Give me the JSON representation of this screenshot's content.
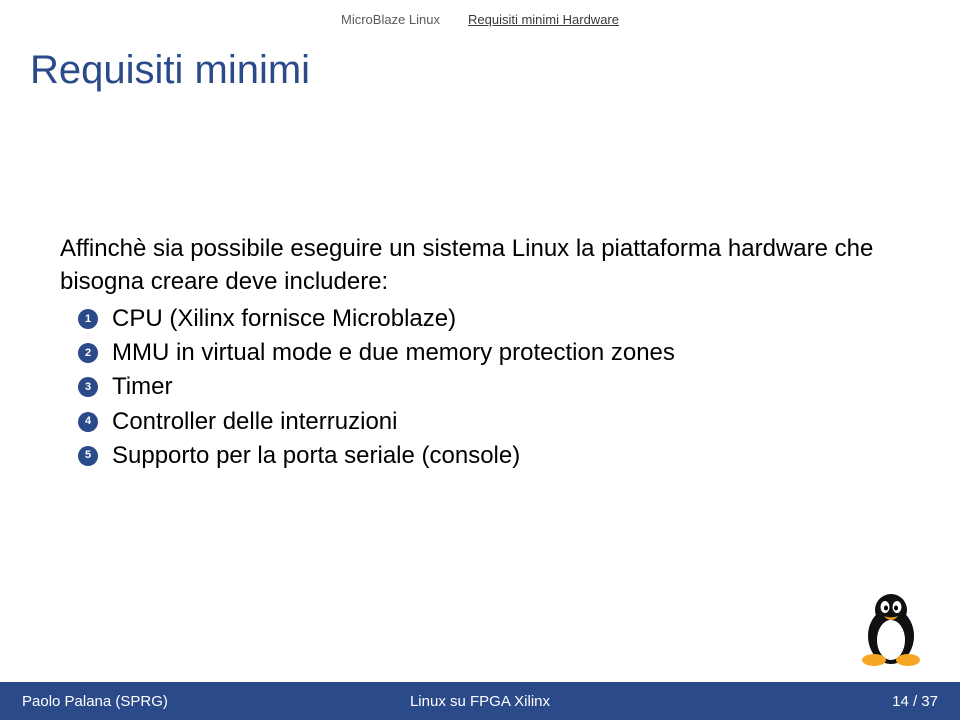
{
  "nav": {
    "left": "MicroBlaze Linux",
    "right": "Requisiti minimi Hardware"
  },
  "title": "Requisiti minimi",
  "lead": "Affinchè sia possibile eseguire un sistema Linux la piattaforma hardware che bisogna creare deve includere:",
  "items": [
    "CPU (Xilinx fornisce Microblaze)",
    "MMU in virtual mode e due memory protection zones",
    "Timer",
    "Controller delle interruzioni",
    "Supporto per la porta seriale (console)"
  ],
  "bullet_labels": [
    "1",
    "2",
    "3",
    "4",
    "5"
  ],
  "footer": {
    "author": "Paolo Palana (SPRG)",
    "talk": "Linux su FPGA Xilinx",
    "page": "14 / 37"
  }
}
